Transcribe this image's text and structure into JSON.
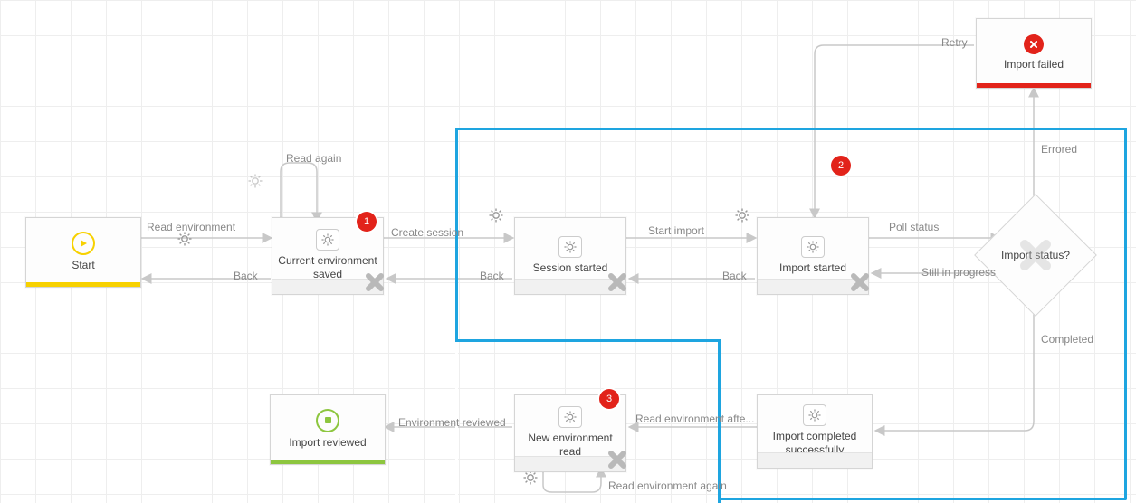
{
  "nodes": {
    "start": {
      "label": "Start"
    },
    "currentEnv": {
      "label": "Current environment saved"
    },
    "sessionStarted": {
      "label": "Session started"
    },
    "importStarted": {
      "label": "Import started"
    },
    "importFailed": {
      "label": "Import failed"
    },
    "decision": {
      "label": "Import status?"
    },
    "importCompleted": {
      "label": "Import completed successfully"
    },
    "newEnvRead": {
      "label": "New environment read"
    },
    "importReviewed": {
      "label": "Import reviewed"
    }
  },
  "edges": {
    "readEnv": "Read environment",
    "back1": "Back",
    "readAgain": "Read again",
    "createSession": "Create session",
    "back2": "Back",
    "startImport": "Start import",
    "back3": "Back",
    "pollStatus": "Poll status",
    "stillInProgress": "Still in progress",
    "errored": "Errored",
    "retry": "Retry",
    "completed": "Completed",
    "readEnvAfter": "Read environment afte...",
    "readEnvAgain": "Read environment again",
    "envReviewed": "Environment reviewed"
  },
  "markers": {
    "m1": "1",
    "m2": "2",
    "m3": "3"
  },
  "colors": {
    "yellow": "#f7d100",
    "green": "#8dc63f",
    "red": "#e2231a",
    "blue": "#1ea5e0",
    "gray": "#b9b9b9"
  }
}
